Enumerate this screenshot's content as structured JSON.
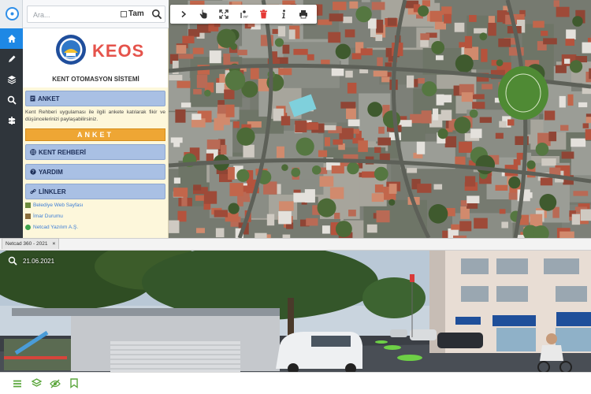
{
  "search": {
    "placeholder": "Ara...",
    "full_label": "Tam"
  },
  "brand": {
    "name": "KEOS",
    "subtitle": "KENT OTOMASYON SİSTEMİ"
  },
  "sections": [
    {
      "label": "ANKET"
    },
    {
      "label": "KENT REHBERİ"
    },
    {
      "label": "YARDIM"
    },
    {
      "label": "LİNKLER"
    }
  ],
  "anket": {
    "description": "Kent Rehberi uygulaması ile ilgili ankete katılarak fikir ve düşüncelerinizi paylaşabilirsiniz.",
    "button_label": "ANKET"
  },
  "links": [
    {
      "label": "Belediye Web Sayfası"
    },
    {
      "label": "İmar Durumu"
    },
    {
      "label": "Netcad Yazılım A.Ş."
    }
  ],
  "tab": {
    "label": "Netcad 360 - 2021",
    "close": "×"
  },
  "streetview": {
    "date": "21.06.2021"
  },
  "colors": {
    "accent": "#1e88e5",
    "brand": "#e5534b",
    "section_bg": "#a9c0e4",
    "anket_button": "#eea634",
    "panel_bg": "#fdf7db",
    "rail": "#2f353b"
  },
  "icons": {
    "rail": [
      "home-icon",
      "pen-icon",
      "layers-icon",
      "search-icon",
      "route-icon"
    ],
    "toolbar": [
      "chevron-right-icon",
      "hand-pointer-icon",
      "fullscreen-icon",
      "measure-icon",
      "trash-icon",
      "info-icon",
      "print-icon"
    ],
    "bottom": [
      "menu-icon",
      "layers-icon",
      "eye-slash-icon",
      "bookmark-icon"
    ]
  }
}
